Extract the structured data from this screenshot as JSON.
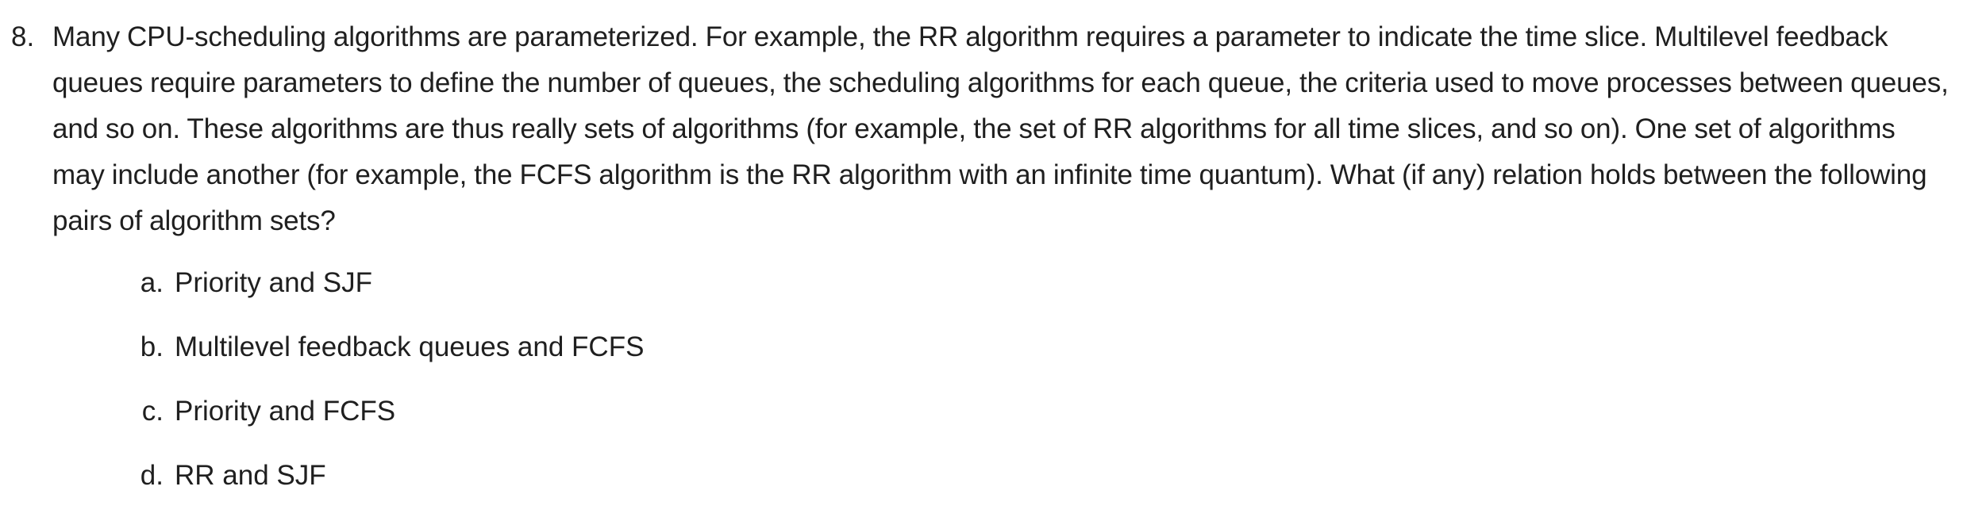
{
  "question": {
    "number": "8.",
    "text": "Many CPU-scheduling algorithms are parameterized. For example, the RR algorithm requires a parameter to indicate the time slice. Multilevel feedback queues require parameters to define the number of queues, the scheduling algorithms for each queue, the criteria used to move processes between queues, and so on. These algorithms are thus really sets of algorithms (for example, the set of RR algorithms for all time slices, and so on). One set of algorithms may include another (for example, the FCFS algorithm is the RR algorithm with an infinite time quantum). What (if any) relation holds between the following pairs of algorithm sets?",
    "options": [
      {
        "letter": "a.",
        "text": "Priority and SJF"
      },
      {
        "letter": "b.",
        "text": "Multilevel feedback queues and FCFS"
      },
      {
        "letter": "c.",
        "text": "Priority and FCFS"
      },
      {
        "letter": "d.",
        "text": "RR and SJF"
      }
    ]
  }
}
